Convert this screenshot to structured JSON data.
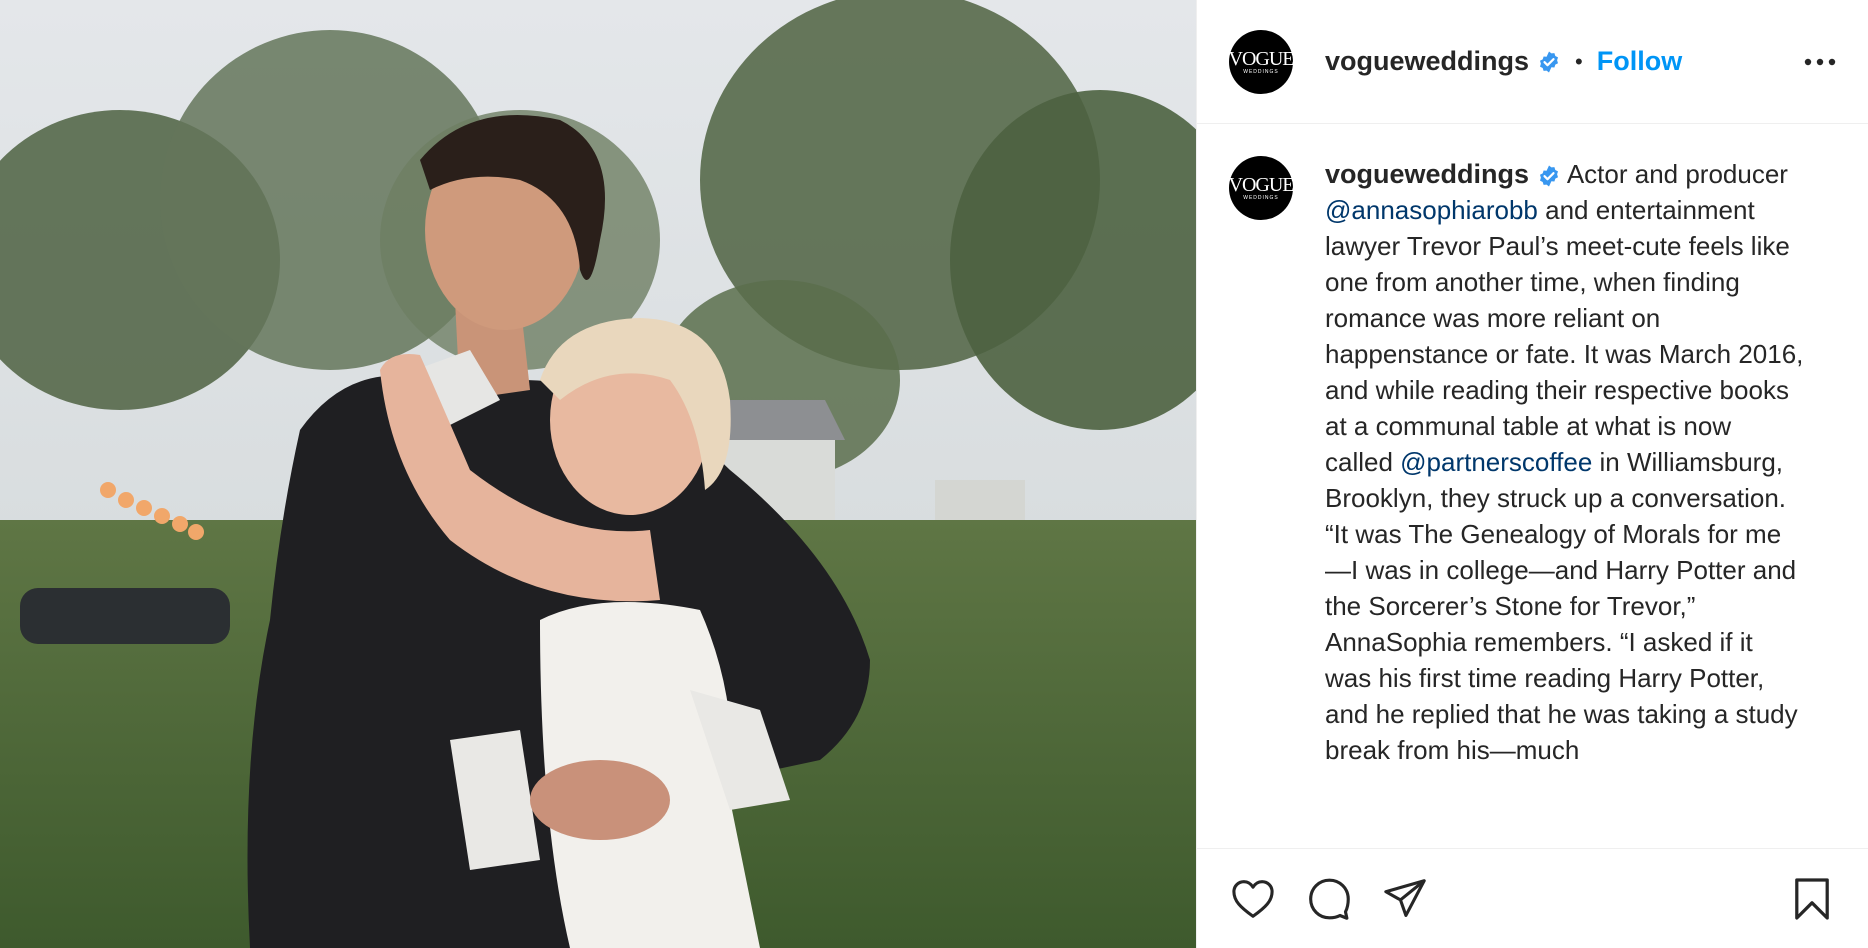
{
  "post": {
    "account": {
      "avatar_line1": "VOGUE",
      "avatar_line2": "WEDDINGS",
      "username": "vogueweddings",
      "verified_icon": "verified-badge-icon",
      "separator": "•",
      "follow_label": "Follow"
    },
    "caption": {
      "username": "vogueweddings",
      "text_1": " Actor and producer ",
      "mention_1": "@annasophiarobb",
      "text_2": " and entertainment lawyer Trevor Paul’s meet-cute feels like one from another time, when finding romance was more reliant on happenstance or fate. It was March 2016, and while reading their respective books at a communal table at what is now called ",
      "mention_2": "@partnerscoffee",
      "text_3": " in Williamsburg, Brooklyn, they struck up a conversation. “It was The Genealogy of Morals for me—I was in college—and Harry Potter and the Sorcerer’s Stone for Trevor,” AnnaSophia remembers. “I asked if it was his first time reading Harry Potter, and he replied that he was taking a study break from his—much"
    },
    "actions": {
      "like_icon": "heart-icon",
      "comment_icon": "comment-icon",
      "share_icon": "paper-plane-icon",
      "save_icon": "bookmark-icon"
    },
    "colors": {
      "accent": "#0095f6",
      "mention": "#00376b",
      "verified": "#3897f0",
      "text": "#262626"
    }
  }
}
